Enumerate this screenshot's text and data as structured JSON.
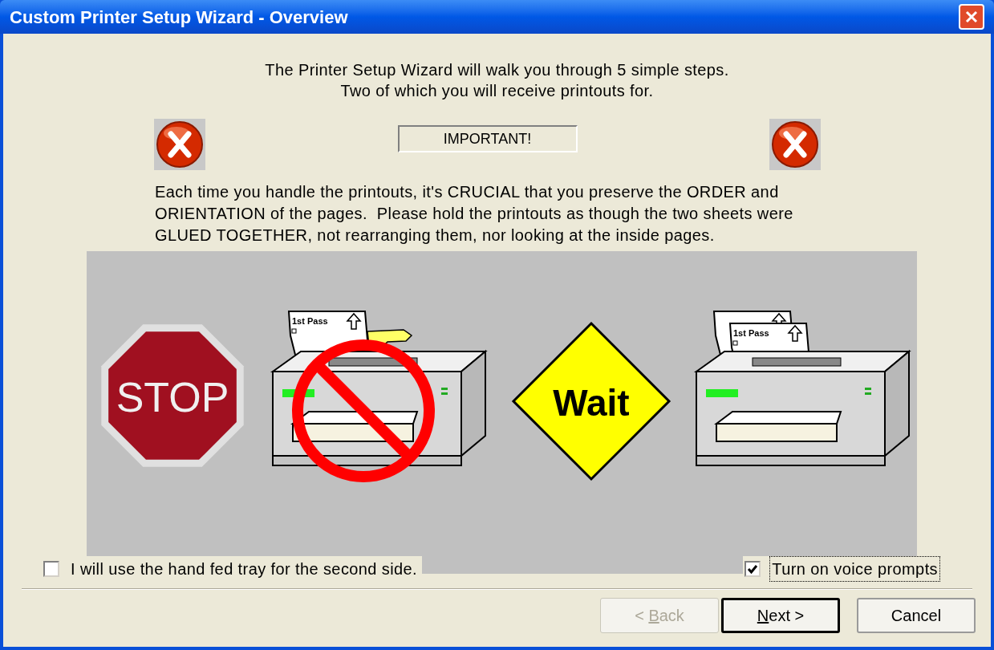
{
  "window": {
    "title": "Custom Printer Setup Wizard - Overview"
  },
  "intro": [
    "The Printer Setup Wizard will walk you through 5 simple steps.",
    "Two of which you will receive printouts for."
  ],
  "important_label": "IMPORTANT!",
  "warning_lines": [
    "Each time you handle the printouts, it's CRUCIAL that you preserve the ORDER and",
    "ORIENTATION of the pages.  Please hold the printouts as though the two sheets were",
    "GLUED TOGETHER, not rearranging them, nor looking at the inside pages."
  ],
  "illustration": {
    "stop_sign": "STOP",
    "first_page_label": "1st Pass",
    "wait_sign": "Wait",
    "second_page_label": "1st Pass"
  },
  "options": [
    {
      "label": "I will use the hand fed tray for the second side.",
      "checked": false,
      "focused": false
    },
    {
      "label": "Turn on voice prompts",
      "checked": true,
      "focused": true
    }
  ],
  "buttons": [
    {
      "prefix": "< ",
      "access_key": "B",
      "rest": "ack",
      "disabled": true,
      "default": false
    },
    {
      "access_key": "N",
      "rest": "ext >",
      "disabled": false,
      "default": true
    },
    {
      "prefix": "Cancel",
      "disabled": false,
      "default": false
    }
  ]
}
